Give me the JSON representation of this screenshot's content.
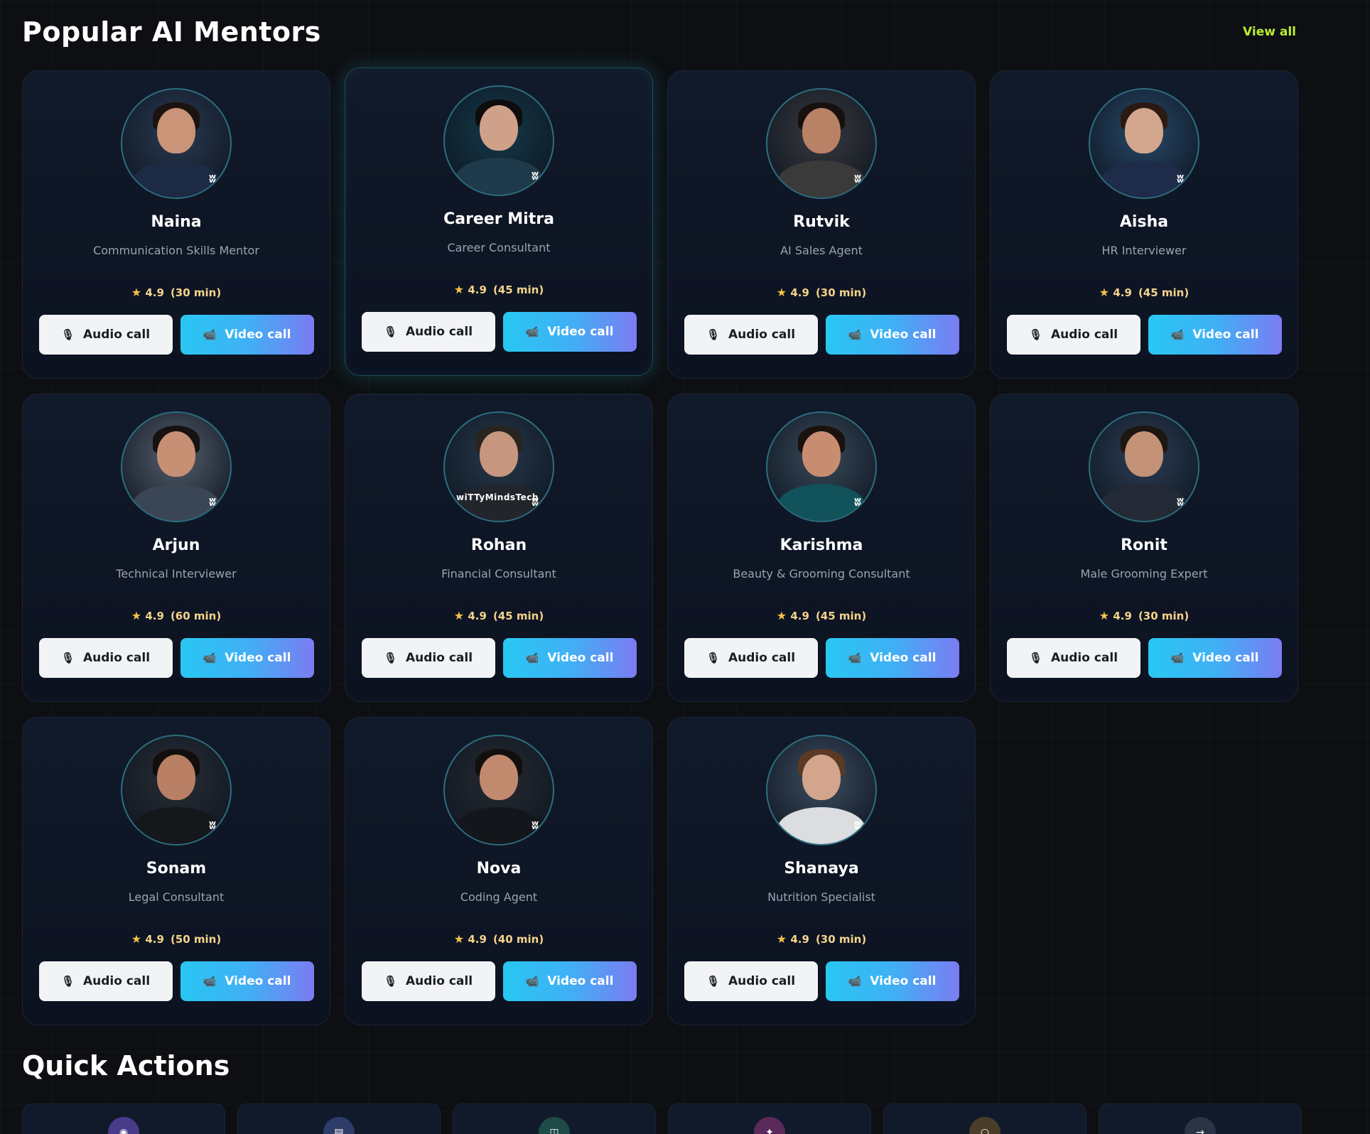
{
  "header": {
    "title": "Popular AI Mentors",
    "view_all": "View all"
  },
  "labels": {
    "audio": "Audio call",
    "video": "Video call",
    "rating_star": "★",
    "audio_icon": "🎙",
    "video_icon": "📹"
  },
  "mentors": [
    {
      "name": "Naina",
      "role": "Communication Skills Mentor",
      "rating": "4.9",
      "duration": "(30 min)",
      "skin": "#c99478",
      "hair": "#1b1310",
      "outfit": "#1c2a44",
      "bg": "#2a3a52"
    },
    {
      "name": "Career Mitra",
      "role": "Career Consultant",
      "rating": "4.9",
      "duration": "(45 min)",
      "skin": "#d0a18a",
      "hair": "#0f0d0c",
      "outfit": "#1f3a4a",
      "bg": "#143a4a"
    },
    {
      "name": "Rutvik",
      "role": "AI Sales Agent",
      "rating": "4.9",
      "duration": "(30 min)",
      "skin": "#b98266",
      "hair": "#17110e",
      "outfit": "#3a3a3a",
      "bg": "#3a3a3e"
    },
    {
      "name": "Aisha",
      "role": "HR Interviewer",
      "rating": "4.9",
      "duration": "(45 min)",
      "skin": "#d3a78e",
      "hair": "#2a1a12",
      "outfit": "#1e2c4a",
      "bg": "#284a6a"
    },
    {
      "name": "Arjun",
      "role": "Technical Interviewer",
      "rating": "4.9",
      "duration": "(60 min)",
      "skin": "#c79075",
      "hair": "#161210",
      "outfit": "#3a4656",
      "bg": "#56606c"
    },
    {
      "name": "Rohan",
      "role": "Financial Consultant",
      "rating": "4.9",
      "duration": "(45 min)",
      "skin": "#c6977e",
      "hair": "#2a2420",
      "outfit": "#22262c",
      "bg": "#27394a",
      "watermark": "wiTTyMindsTech"
    },
    {
      "name": "Karishma",
      "role": "Beauty & Grooming Consultant",
      "rating": "4.9",
      "duration": "(45 min)",
      "skin": "#c88d70",
      "hair": "#1b120e",
      "outfit": "#12525a",
      "bg": "#3a4a5a"
    },
    {
      "name": "Ronit",
      "role": "Male Grooming Expert",
      "rating": "4.9",
      "duration": "(30 min)",
      "skin": "#c49277",
      "hair": "#1d1612",
      "outfit": "#232a36",
      "bg": "#2c3e54"
    },
    {
      "name": "Sonam",
      "role": "Legal Consultant",
      "rating": "4.9",
      "duration": "(50 min)",
      "skin": "#b98066",
      "hair": "#120e0c",
      "outfit": "#15171b",
      "bg": "#2a2e34"
    },
    {
      "name": "Nova",
      "role": "Coding Agent",
      "rating": "4.9",
      "duration": "(40 min)",
      "skin": "#c18a6f",
      "hair": "#130f0d",
      "outfit": "#14161b",
      "bg": "#272b31"
    },
    {
      "name": "Shanaya",
      "role": "Nutrition Specialist",
      "rating": "4.9",
      "duration": "(30 min)",
      "skin": "#d2a58c",
      "hair": "#5a3a24",
      "outfit": "#dcdde0",
      "bg": "#3e4e60"
    }
  ],
  "quick_actions": {
    "title": "Quick Actions",
    "items": [
      {
        "icon": "mic-icon",
        "glyph": "◉",
        "color": "#4a3a8a"
      },
      {
        "icon": "document-icon",
        "glyph": "▤",
        "color": "#2e3c6a"
      },
      {
        "icon": "grid-icon",
        "glyph": "◫",
        "color": "#1e4a48"
      },
      {
        "icon": "sparkle-icon",
        "glyph": "✦",
        "color": "#5a2a5a"
      },
      {
        "icon": "circle-icon",
        "glyph": "○",
        "color": "#4a3e2a"
      },
      {
        "icon": "arrow-icon",
        "glyph": "→",
        "color": "#2a3446"
      }
    ]
  }
}
